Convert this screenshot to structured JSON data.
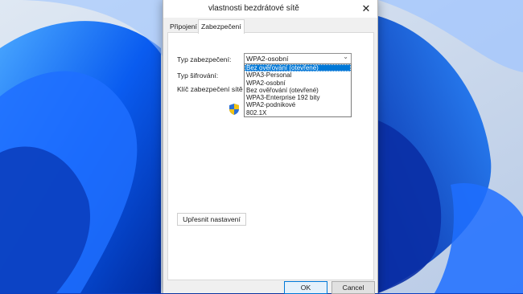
{
  "window": {
    "title": "vlastnosti bezdrátové sítě"
  },
  "tabs": [
    {
      "label": "Připojení"
    },
    {
      "label": "Zabezpečení"
    }
  ],
  "security": {
    "type_label": "Typ zabezpečení:",
    "encryption_label": "Typ šifrování:",
    "key_label": "Klíč zabezpečení sítě",
    "selected_type": "WPA2-osobní",
    "options": [
      "Bez ověřování (otevřené)",
      "WPA3-Personal",
      "WPA2-osobní",
      "Bez ověřování (otevřené)",
      "WPA3-Enterprise 192 bity",
      "WPA2-podnikové",
      "802.1X"
    ],
    "highlighted_option": "Bez ověřování (otevřené)"
  },
  "buttons": {
    "advanced": "Upřesnit nastavení",
    "ok": "OK",
    "cancel": "Cancel"
  },
  "icons": {
    "close": "close-icon",
    "chevron": "chevron-down-icon",
    "shield": "uac-shield-icon"
  },
  "colors": {
    "accent": "#0078d7",
    "wallpaper": "#0b3fbf"
  }
}
